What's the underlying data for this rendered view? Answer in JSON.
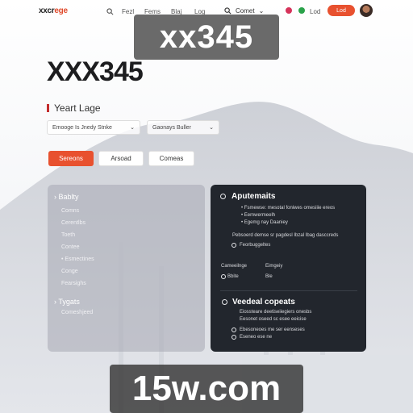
{
  "brand": {
    "logo_main": "xxcr",
    "logo_accent": "ege",
    "accent_color": "#e8512f"
  },
  "nav": {
    "items": [
      "Fezl",
      "Fems",
      "Blaj",
      "Log"
    ],
    "search_label": "Comet",
    "cta_label": "Lod",
    "text_badge": "Lod"
  },
  "watermarks": {
    "top": "xx345",
    "bottom": "15w.com"
  },
  "hero": {
    "title": "XXX345",
    "subhead": "Yeart Lage"
  },
  "filters": [
    {
      "label": "Emooge Is Jnedy Stnke"
    },
    {
      "label": "Gaonays Buller"
    }
  ],
  "tabs": [
    {
      "label": "Sereons"
    },
    {
      "label": "Arsoad"
    },
    {
      "label": "Comeas"
    }
  ],
  "left_panel": {
    "section1_title": "Bablty",
    "section1_items": [
      "Comns",
      "Cerentlbs",
      "Toeth",
      "Contee",
      "Esmectines",
      "Conge",
      "Fearsighs"
    ],
    "section2_title": "Tygats",
    "section2_items": [
      "Comeshjeed"
    ]
  },
  "right_panel": {
    "section1_title": "Aputemaits",
    "bullets": [
      "Fsmewse: mesotal foniwes omesiiie ereos",
      "Eemwermeelh",
      "Egemg nay Daaniey"
    ],
    "paragraph": "Pebsoerd demse sr pagdesl Ibzal Ibag dasccreds",
    "option1": "Feorbuggeltes",
    "row1_left": "Cameeilnge",
    "row1_right": "Eimgeiy",
    "row2_left": "Bbite",
    "row2_right": "Ble",
    "section2_title": "Veedeal copeats",
    "section2_line1": "Eiossteare deetiseiiegiers onesbs",
    "section2_line2": "Eesonet oseed sc esee eeicise",
    "option2": "Ebesoneoes me ser eenseses",
    "option3": "Eseneo ese ne"
  }
}
